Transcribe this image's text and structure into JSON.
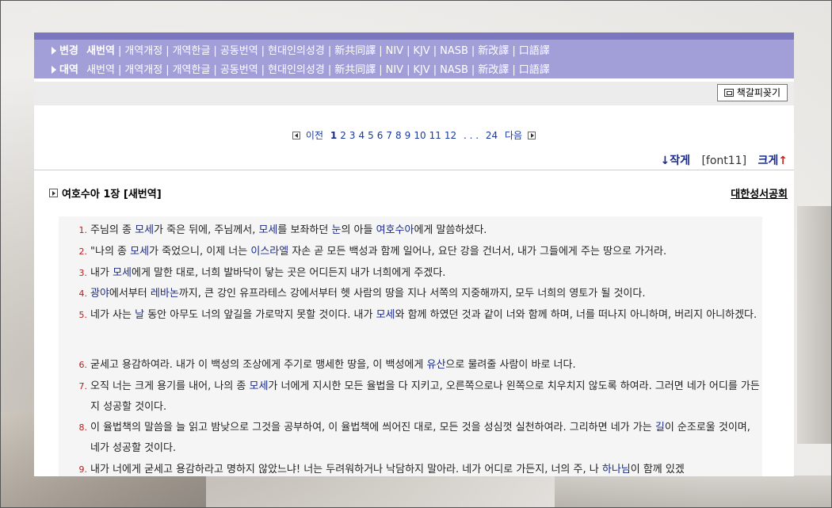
{
  "nav": {
    "row1": {
      "category": "변경",
      "links": [
        "새번역",
        "개역개정",
        "개역한글",
        "공동번역",
        "현대인의성경",
        "新共同譯",
        "NIV",
        "KJV",
        "NASB",
        "新改譯",
        "口語譯"
      ]
    },
    "row2": {
      "category": "대역",
      "links": [
        "새번역",
        "개역개정",
        "개역한글",
        "공동번역",
        "현대인의성경",
        "新共同譯",
        "NIV",
        "KJV",
        "NASB",
        "新改譯",
        "口語譯"
      ]
    }
  },
  "toolbar": {
    "bookmark_label": "책갈피꽂기"
  },
  "pager": {
    "prev_label": "이전",
    "pages": [
      "1",
      "2",
      "3",
      "4",
      "5",
      "6",
      "7",
      "8",
      "9",
      "10",
      "11",
      "12"
    ],
    "ellipsis": ". . .",
    "last_page": "24",
    "next_label": "다음",
    "current": "1"
  },
  "font_control": {
    "smaller_label": "작게",
    "current": "[font11]",
    "bigger_label": "크게",
    "smaller_arrow": "↓",
    "bigger_arrow": "↑"
  },
  "chapter": {
    "title": "여호수아 1장 [새번역]",
    "publisher": "대한성서공회"
  },
  "verses": [
    {
      "num": "1.",
      "parts": [
        [
          "t",
          "주님의 종 "
        ],
        [
          "w",
          "모세"
        ],
        [
          "t",
          "가 죽은 뒤에, 주님께서, "
        ],
        [
          "w",
          "모세"
        ],
        [
          "t",
          "를 보좌하던 "
        ],
        [
          "w",
          "눈"
        ],
        [
          "t",
          "의 아들 "
        ],
        [
          "w",
          "여호수아"
        ],
        [
          "t",
          "에게 말씀하셨다."
        ]
      ]
    },
    {
      "num": "2.",
      "parts": [
        [
          "t",
          "\"나의 종 "
        ],
        [
          "w",
          "모세"
        ],
        [
          "t",
          "가 죽었으니, 이제 너는 "
        ],
        [
          "w",
          "이스라엘"
        ],
        [
          "t",
          " 자손 곧 모든 백성과 함께 일어나, 요단 강을 건너서, 내가 그들에게 주는 땅으로 가거라."
        ]
      ]
    },
    {
      "num": "3.",
      "parts": [
        [
          "t",
          "내가 "
        ],
        [
          "w",
          "모세"
        ],
        [
          "t",
          "에게 말한 대로, 너희 발바닥이 닿는 곳은 어디든지 내가 너희에게 주겠다."
        ]
      ]
    },
    {
      "num": "4.",
      "parts": [
        [
          "w",
          "광야"
        ],
        [
          "t",
          "에서부터 "
        ],
        [
          "w",
          "레바논"
        ],
        [
          "t",
          "까지, 큰 강인 유프라테스 강에서부터 헷 사람의 땅을 지나 서쪽의 지중해까지, 모두 너희의 영토가 될 것이다."
        ]
      ]
    },
    {
      "num": "5.",
      "parts": [
        [
          "t",
          "네가 사는 "
        ],
        [
          "w",
          "날"
        ],
        [
          "t",
          " 동안 아무도 너의 앞길을 가로막지 못할 것이다. 내가 "
        ],
        [
          "w",
          "모세"
        ],
        [
          "t",
          "와 함께 하였던 것과 같이 너와 함께 하며, 너를 떠나지 아니하며, 버리지 아니하겠다."
        ]
      ]
    },
    {
      "num": "6.",
      "parts": [
        [
          "t",
          "굳세고 용감하여라. 내가 이 백성의 조상에게 주기로 맹세한 땅을, 이 백성에게 "
        ],
        [
          "w",
          "유산"
        ],
        [
          "t",
          "으로 물려줄 사람이 바로 너다."
        ]
      ]
    },
    {
      "num": "7.",
      "parts": [
        [
          "t",
          "오직 너는 크게 용기를 내어, 나의 종 "
        ],
        [
          "w",
          "모세"
        ],
        [
          "t",
          "가 너에게 지시한 모든 율법을 다 지키고, 오른쪽으로나 왼쪽으로 치우치지 않도록 하여라. 그러면 네가 어디를 가든지 성공할 것이다."
        ]
      ]
    },
    {
      "num": "8.",
      "parts": [
        [
          "t",
          "이 율법책의 말씀을 늘 읽고 밤낮으로 그것을 공부하여, 이 율법책에 씌어진 대로, 모든 것을 성심껏 실천하여라. 그리하면 네가 가는 "
        ],
        [
          "w",
          "길"
        ],
        [
          "t",
          "이 순조로울 것이며, 네가 성공할 것이다."
        ]
      ]
    },
    {
      "num": "9.",
      "parts": [
        [
          "t",
          "내가 너에게 굳세고 용감하라고 명하지 않았느냐! 너는 두려워하거나 낙담하지 말아라. 네가 어디로 가든지, 너의 주, 나 "
        ],
        [
          "w",
          "하나님"
        ],
        [
          "t",
          "이 함께 있겠"
        ]
      ]
    }
  ]
}
